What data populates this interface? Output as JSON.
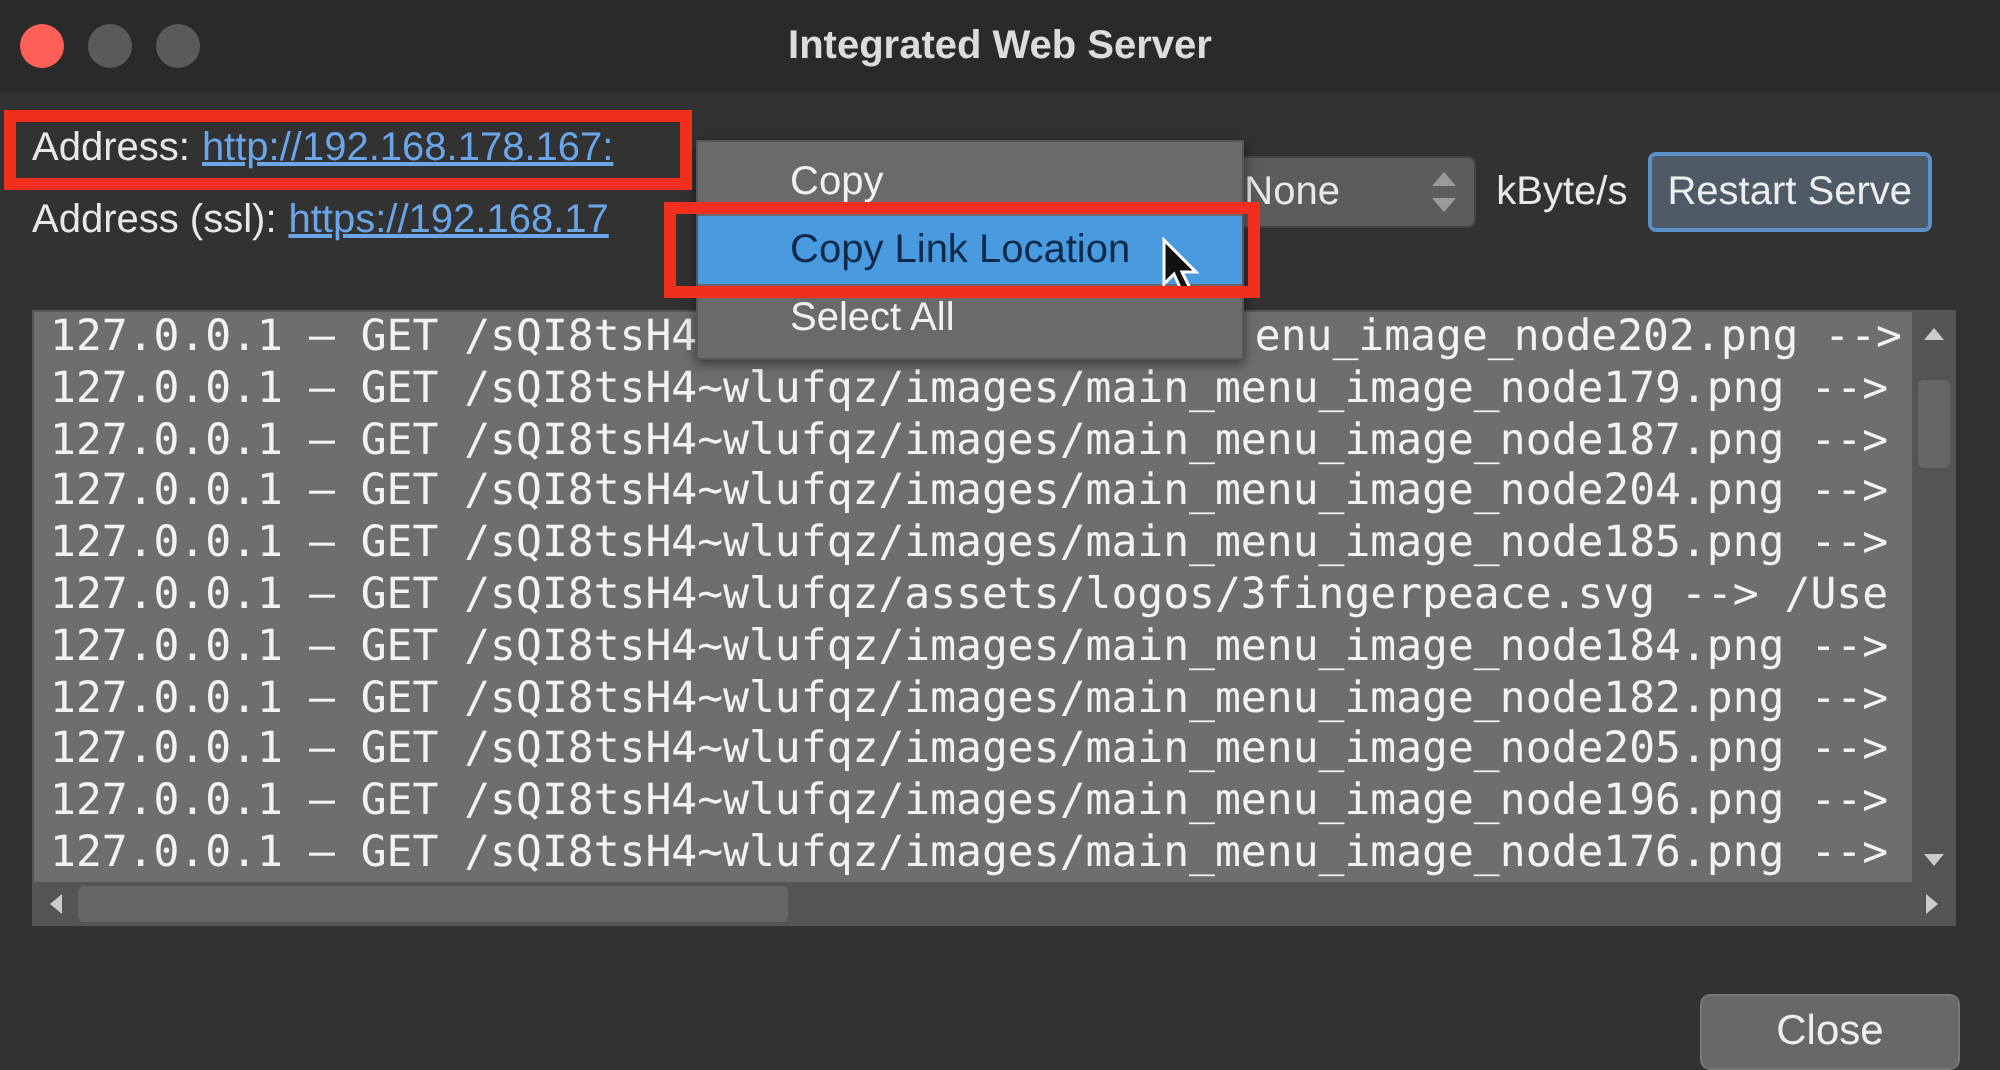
{
  "window": {
    "title": "Integrated Web Server"
  },
  "address": {
    "label": "Address:",
    "link": "http://192.168.178.167:"
  },
  "address_ssl": {
    "label": "Address (ssl):",
    "link": "https://192.168.17"
  },
  "limit": {
    "value": "None",
    "unit": "kByte/s"
  },
  "restart_button": "Restart Serve",
  "log": [
    {
      "left": "127.0.0.1 – GET /sQI8tsH4",
      "right": "enu_image_node202.png -->"
    },
    {
      "text": "127.0.0.1 – GET /sQI8tsH4~wlufqz/images/main_menu_image_node179.png -->"
    },
    {
      "text": "127.0.0.1 – GET /sQI8tsH4~wlufqz/images/main_menu_image_node187.png -->"
    },
    {
      "text": "127.0.0.1 – GET /sQI8tsH4~wlufqz/images/main_menu_image_node204.png -->"
    },
    {
      "text": "127.0.0.1 – GET /sQI8tsH4~wlufqz/images/main_menu_image_node185.png -->"
    },
    {
      "text": "127.0.0.1 – GET /sQI8tsH4~wlufqz/assets/logos/3fingerpeace.svg --> /Use"
    },
    {
      "text": "127.0.0.1 – GET /sQI8tsH4~wlufqz/images/main_menu_image_node184.png -->"
    },
    {
      "text": "127.0.0.1 – GET /sQI8tsH4~wlufqz/images/main_menu_image_node182.png -->"
    },
    {
      "text": "127.0.0.1 – GET /sQI8tsH4~wlufqz/images/main_menu_image_node205.png -->"
    },
    {
      "text": "127.0.0.1 – GET /sQI8tsH4~wlufqz/images/main_menu_image_node196.png -->"
    },
    {
      "text": "127.0.0.1 – GET /sQI8tsH4~wlufqz/images/main_menu_image_node176.png -->"
    }
  ],
  "context_menu": [
    {
      "label": "Copy",
      "selected": false
    },
    {
      "label": "Copy Link Location",
      "selected": true
    },
    {
      "label": "Select All",
      "selected": false
    }
  ],
  "close_button": "Close"
}
